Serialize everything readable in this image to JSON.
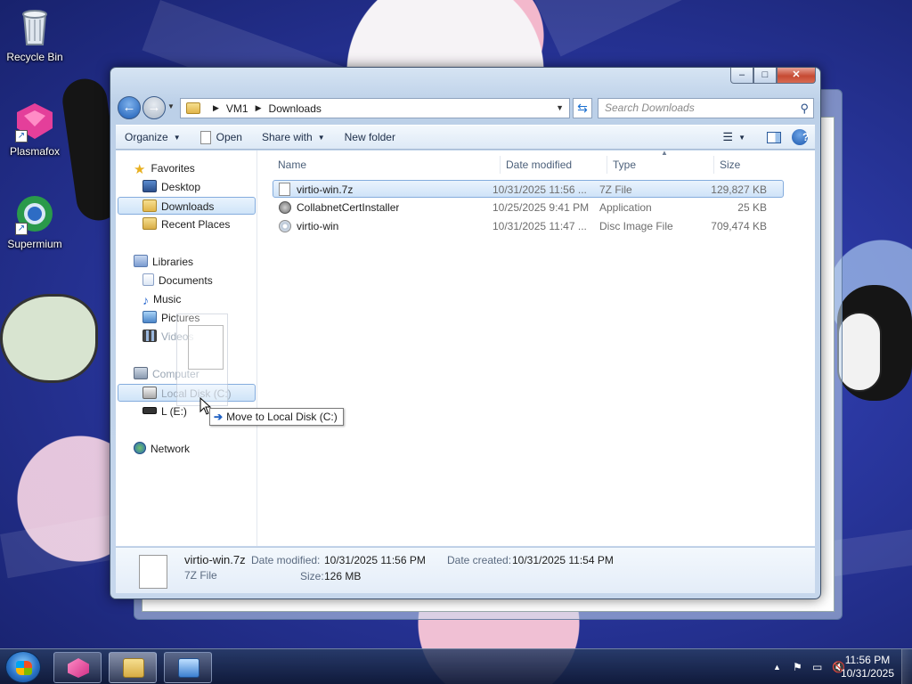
{
  "desktop": {
    "icons": [
      {
        "label": "Recycle Bin",
        "icon": "recycle-bin-icon"
      },
      {
        "label": "Plasmafox",
        "icon": "plasmafox-icon"
      },
      {
        "label": "Supermium",
        "icon": "supermium-icon"
      }
    ]
  },
  "window": {
    "caption": {
      "minimize": "–",
      "maximize": "□",
      "close": "✕"
    },
    "address": {
      "crumbs": [
        "VM1",
        "Downloads"
      ]
    },
    "search": {
      "placeholder": "Search Downloads"
    },
    "toolbar": {
      "organize": "Organize",
      "open": "Open",
      "share_with": "Share with",
      "new_folder": "New folder"
    },
    "nav_pane": {
      "favorites": {
        "label": "Favorites",
        "items": [
          "Desktop",
          "Downloads",
          "Recent Places"
        ]
      },
      "libraries": {
        "label": "Libraries",
        "items": [
          "Documents",
          "Music",
          "Pictures",
          "Videos"
        ]
      },
      "computer": {
        "label": "Computer",
        "items": [
          "Local Disk (C:)",
          "L (E:)"
        ]
      },
      "network": {
        "label": "Network"
      }
    },
    "columns": [
      "Name",
      "Date modified",
      "Type",
      "Size"
    ],
    "files": [
      {
        "name": "virtio-win.7z",
        "date": "10/31/2025 11:56 ...",
        "type": "7Z File",
        "size": "129,827 KB",
        "selected": true
      },
      {
        "name": "CollabnetCertInstaller",
        "date": "10/25/2025 9:41 PM",
        "type": "Application",
        "size": "25 KB",
        "selected": false
      },
      {
        "name": "virtio-win",
        "date": "10/31/2025 11:47 ...",
        "type": "Disc Image File",
        "size": "709,474 KB",
        "selected": false
      }
    ],
    "details": {
      "name": "virtio-win.7z",
      "type": "7Z File",
      "date_modified_label": "Date modified:",
      "date_modified": "10/31/2025 11:56 PM",
      "date_created_label": "Date created:",
      "date_created": "10/31/2025 11:54 PM",
      "size_label": "Size:",
      "size": "126 MB"
    },
    "drag_tooltip": "Move to Local Disk (C:)"
  },
  "taskbar": {
    "clock_time": "11:56 PM",
    "clock_date": "10/31/2025",
    "tray_icons": [
      "show-hidden-icons",
      "action-center-flag-icon",
      "network-icon",
      "volume-muted-icon"
    ]
  }
}
